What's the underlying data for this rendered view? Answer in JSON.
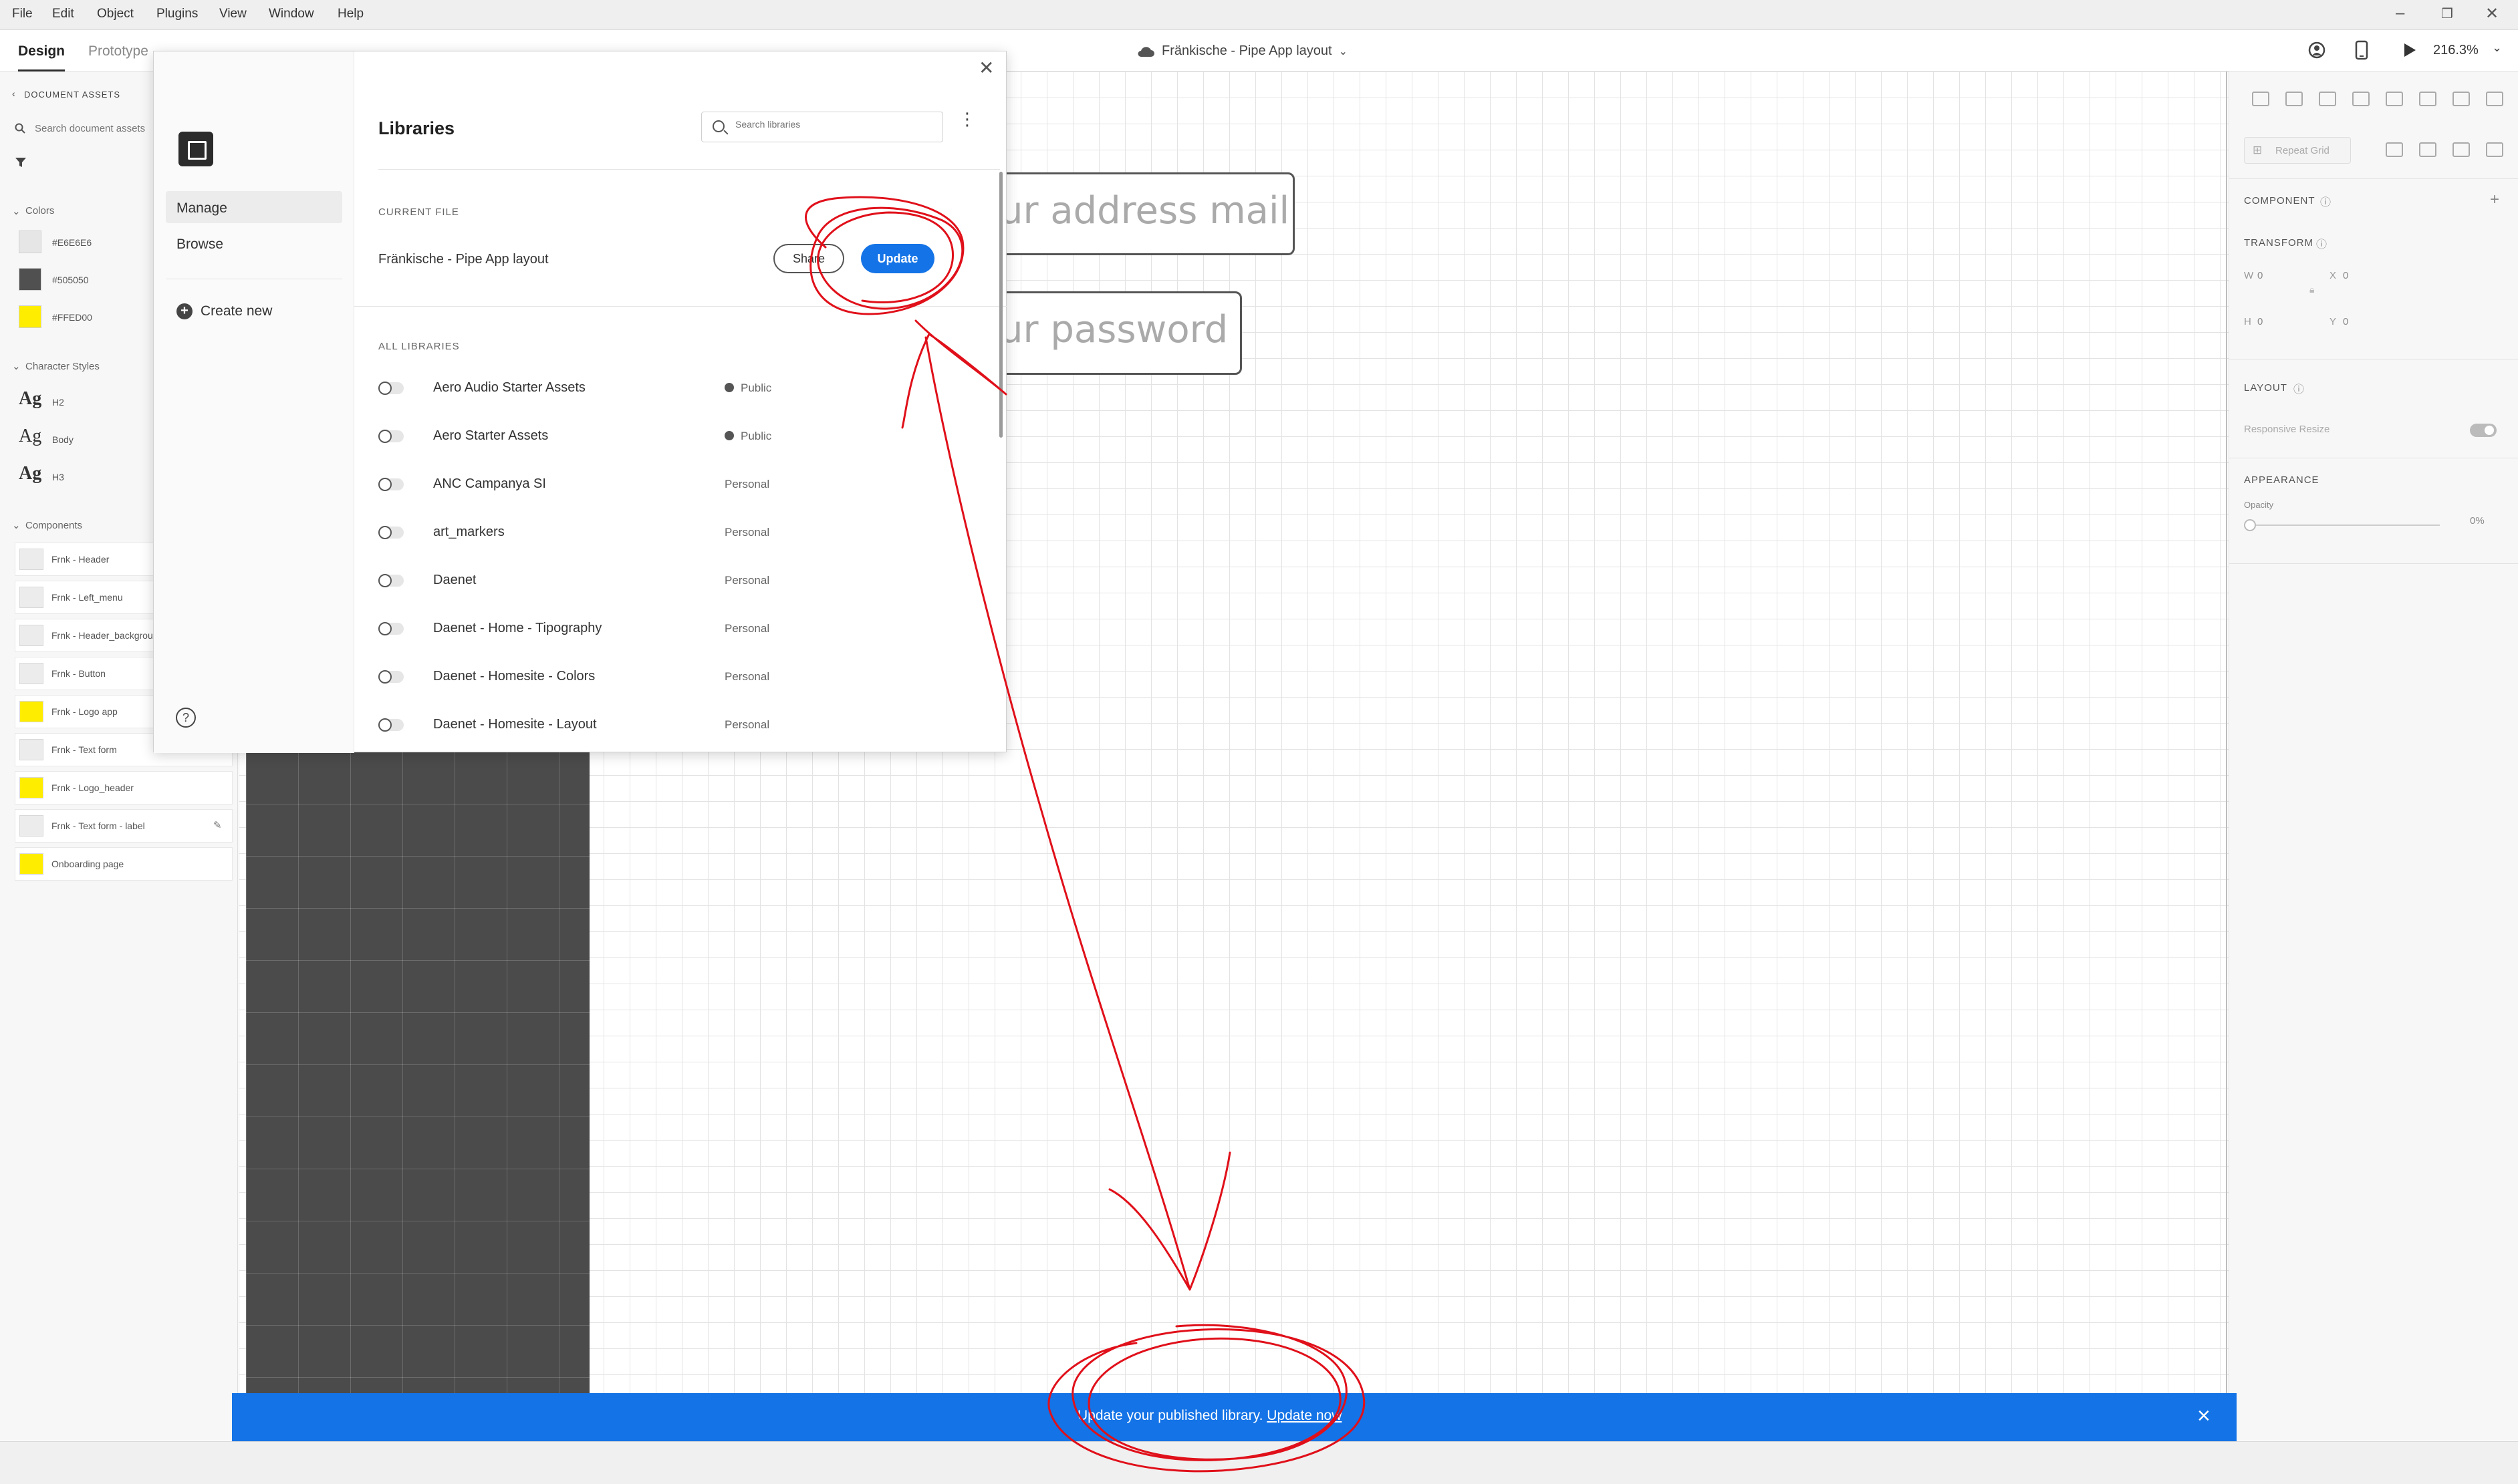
{
  "menu": [
    "File",
    "Edit",
    "Object",
    "Plugins",
    "View",
    "Window",
    "Help"
  ],
  "toolbar": {
    "tabs": [
      "Design",
      "Prototype"
    ],
    "doc_title": "Fränkische - Pipe App layout",
    "zoom": "216.3%"
  },
  "left_panel": {
    "back_label": "DOCUMENT ASSETS",
    "search_placeholder": "Search document assets",
    "colors_heading": "Colors",
    "colors": [
      {
        "hex": "#E6E6E6",
        "label": "#E6E6E6"
      },
      {
        "hex": "#505050",
        "label": "#505050"
      },
      {
        "hex": "#FFED00",
        "label": "#FFED00"
      }
    ],
    "char_styles_heading": "Character Styles",
    "char_styles": [
      {
        "glyph": "Ag",
        "label": "H2"
      },
      {
        "glyph": "Ag",
        "label": "Body"
      },
      {
        "glyph": "Ag",
        "label": "H3"
      }
    ],
    "components_heading": "Components",
    "components": [
      "Frnk - Header",
      "Frnk - Left_menu",
      "Frnk - Header_background",
      "Frnk - Button",
      "Frnk - Logo app",
      "Frnk - Text form",
      "Frnk - Logo_header",
      "Frnk - Text form - label",
      "Onboarding page"
    ]
  },
  "canvas": {
    "field_email_text": "ur address mail",
    "field_password_text": "ur password"
  },
  "dialog": {
    "title": "Libraries",
    "nav": [
      "Manage",
      "Browse"
    ],
    "create_new": "Create new",
    "search_placeholder": "Search libraries",
    "current_file_label": "CURRENT FILE",
    "current_file_name": "Fränkische - Pipe App layout",
    "share_label": "Share",
    "update_label": "Update",
    "all_libraries_label": "ALL LIBRARIES",
    "libraries": [
      {
        "name": "Aero Audio Starter Assets",
        "visibility": "Public"
      },
      {
        "name": "Aero Starter Assets",
        "visibility": "Public"
      },
      {
        "name": "ANC Campanya SI",
        "visibility": "Personal"
      },
      {
        "name": "art_markers",
        "visibility": "Personal"
      },
      {
        "name": "Daenet",
        "visibility": "Personal"
      },
      {
        "name": "Daenet - Home - Tipography",
        "visibility": "Personal"
      },
      {
        "name": "Daenet - Homesite - Colors",
        "visibility": "Personal"
      },
      {
        "name": "Daenet - Homesite - Layout",
        "visibility": "Personal"
      }
    ]
  },
  "right_panel": {
    "repeat_grid": "Repeat Grid",
    "component_heading": "COMPONENT",
    "transform_heading": "TRANSFORM",
    "w_label": "W",
    "w_value": "0",
    "x_label": "X",
    "x_value": "0",
    "h_label": "H",
    "h_value": "0",
    "y_label": "Y",
    "y_value": "0",
    "layout_heading": "LAYOUT",
    "responsive_resize": "Responsive Resize",
    "appearance_heading": "APPEARANCE",
    "opacity_label": "Opacity",
    "opacity_value": "0%"
  },
  "banner": {
    "message": "Update your published library.",
    "link": "Update now"
  },
  "colors": {
    "accent": "#1473E6",
    "annotation": "#E0101A",
    "dark_artboard": "#4B4B4B"
  }
}
